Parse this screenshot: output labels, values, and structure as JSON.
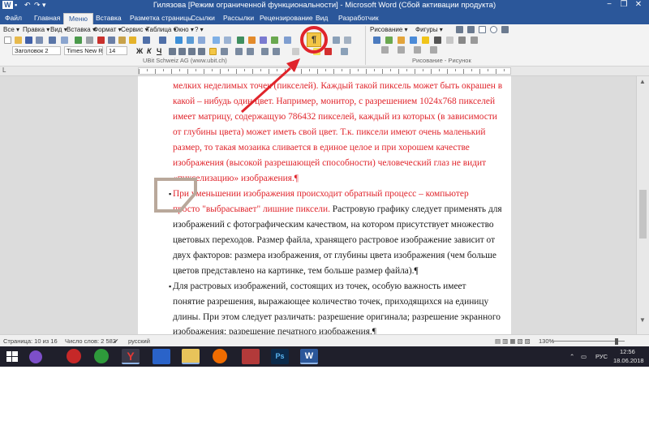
{
  "window": {
    "title": "Гилязова [Режим ограниченной функциональности] - Microsoft Word (Сбой активации продукта)",
    "app_icon_letter": "W",
    "controls": [
      "−",
      "❐",
      "✕"
    ]
  },
  "ribbon_tabs": [
    "Файл",
    "Главная",
    "Меню",
    "Вставка",
    "Разметка страницы",
    "Ссылки",
    "Рассылки",
    "Рецензирование",
    "Вид",
    "Разработчик"
  ],
  "menu_bar": [
    "Все ▾",
    "Правка ▾",
    "Вид ▾",
    "Вставка ▾",
    "Формат ▾",
    "Сервис ▾",
    "Таблица ▾",
    "Окно ▾",
    "? ▾"
  ],
  "toolbar": {
    "style_value": "Заголовок 2",
    "font_value": "Times New Ro",
    "size_value": "14",
    "bold": "Ж",
    "italic": "К",
    "underline": "Ч",
    "show_marks_glyph": "¶",
    "drawing_label": "Рисование ▾",
    "shapes_label": "Фигуры ▾",
    "group_label_left": "UBit Schweiz AG    (www.ubit.ch)",
    "group_label_right": "Рисование - Рисунок"
  },
  "document": {
    "lines": [
      {
        "text": "мелких неделимых точек (пикселей). Каждый такой пиксель может быть окрашен в",
        "color": "red"
      },
      {
        "text": "какой – нибудь один цвет. Например, монитор, с разрешением 1024х768 пикселей",
        "color": "red"
      },
      {
        "text": "имеет матрицу, содержащую 786432 пикселей, каждый из которых (в зависимости",
        "color": "red"
      },
      {
        "text": "от глубины цвета) может иметь свой цвет. Т.к. пиксели имеют очень маленький",
        "color": "red"
      },
      {
        "text": "размер, то такая мозаика сливается в единое целое и при хорошем качестве",
        "color": "red"
      },
      {
        "text": "изображения (высокой разрешающей способности) человеческий глаз не видит",
        "color": "red"
      },
      {
        "text": "«пикселизацию» изображения.¶",
        "color": "red"
      },
      {
        "text": "    При уменьшении изображения происходит обратный процесс – компьютер",
        "color": "red"
      },
      {
        "text": "просто \"выбрасывает\" лишние пиксели. Растровую графику следует применять для",
        "color": "mixed"
      },
      {
        "text": "изображений с фотографическим качеством, на котором присутствует множество",
        "color": "black"
      },
      {
        "text": "цветовых переходов. Размер файла, хранящего растровое изображение зависит от",
        "color": "black"
      },
      {
        "text": "двух факторов: размера изображения, от глубины цвета изображения (чем больше",
        "color": "black"
      },
      {
        "text": "цветов представлено на картинке, тем больше размер файла).¶",
        "color": "black"
      },
      {
        "text": "    Для растровых изображений, состоящих из точек, особую важность имеет",
        "color": "black"
      },
      {
        "text": "понятие разрешения, выражающее количество точек, приходящихся на единицу",
        "color": "black"
      },
      {
        "text": "длины. При этом следует различать: разрешение оригинала; разрешение экранного",
        "color": "black"
      },
      {
        "text": "изображения; разрешение печатного изображения.¶",
        "color": "black"
      }
    ],
    "mixed_line_red_part": "просто \"выбрасывает\" лишние пиксели.",
    "mixed_line_black_part": " Растровую графику следует применять для"
  },
  "status": {
    "page": "Страница: 10 из 16",
    "words": "Число слов: 2 582",
    "language": "русский",
    "zoom": "130%"
  },
  "taskbar": {
    "language": "РУС",
    "time": "12:56",
    "date": "18.06.2018"
  },
  "annotation_colors": {
    "arrow": "#e0242b",
    "circle": "#e0242b",
    "shape_outline": "#b9a89b"
  }
}
